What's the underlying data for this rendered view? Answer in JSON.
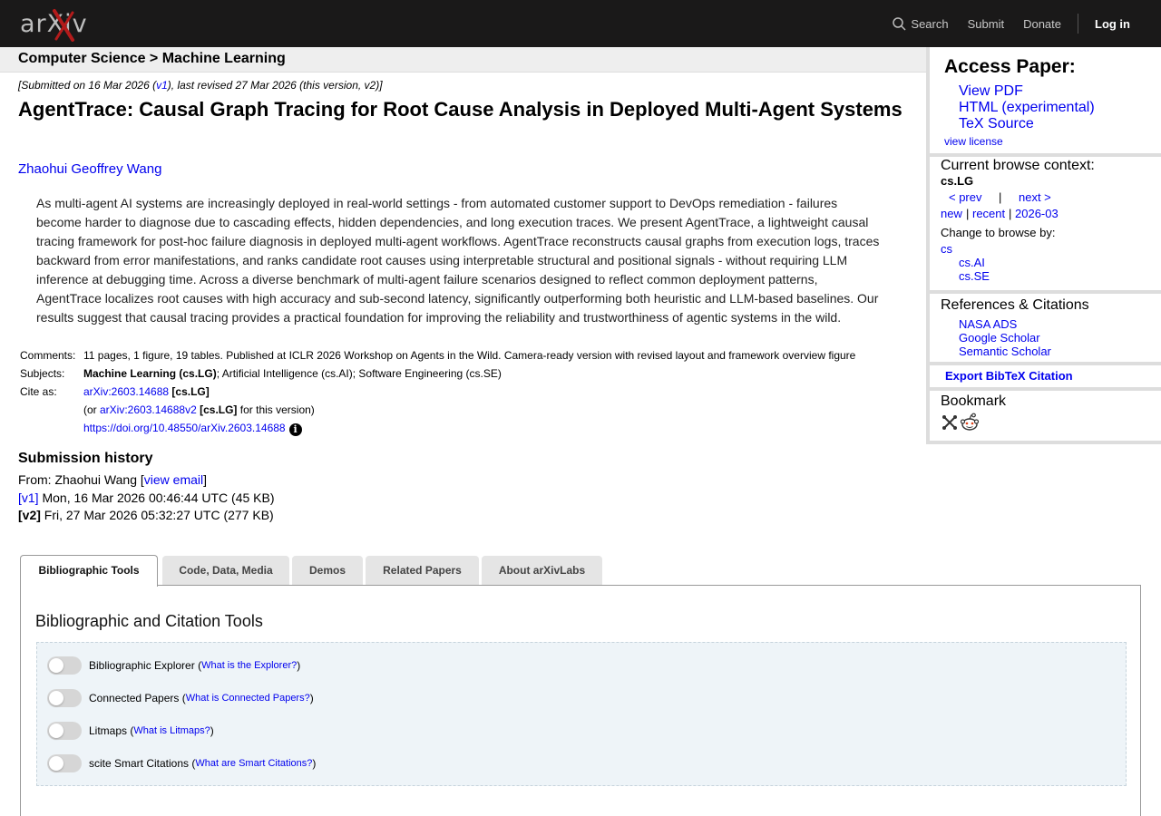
{
  "header": {
    "logo_text": "arXiv",
    "nav": {
      "search": "Search",
      "submit": "Submit",
      "donate": "Donate",
      "login": "Log in"
    }
  },
  "context": {
    "breadcrumb": "Computer Science > Machine Learning"
  },
  "paper": {
    "dateline_prefix": "[Submitted on 16 Mar 2026 (",
    "dateline_v1": "v1",
    "dateline_suffix": "), last revised 27 Mar 2026 (this version, v2)]",
    "title": "AgentTrace: Causal Graph Tracing for Root Cause Analysis in Deployed Multi-Agent Systems",
    "author": "Zhaohui Geoffrey Wang",
    "abstract": "As multi-agent AI systems are increasingly deployed in real-world settings - from automated customer support to DevOps remediation - failures become harder to diagnose due to cascading effects, hidden dependencies, and long execution traces. We present AgentTrace, a lightweight causal tracing framework for post-hoc failure diagnosis in deployed multi-agent workflows. AgentTrace reconstructs causal graphs from execution logs, traces backward from error manifestations, and ranks candidate root causes using interpretable structural and positional signals - without requiring LLM inference at debugging time. Across a diverse benchmark of multi-agent failure scenarios designed to reflect common deployment patterns, AgentTrace localizes root causes with high accuracy and sub-second latency, significantly outperforming both heuristic and LLM-based baselines. Our results suggest that causal tracing provides a practical foundation for improving the reliability and trustworthiness of agentic systems in the wild."
  },
  "meta": {
    "comments_label": "Comments:",
    "comments": "11 pages, 1 figure, 19 tables. Published at ICLR 2026 Workshop on Agents in the Wild. Camera-ready version with revised layout and framework overview figure",
    "subjects_label": "Subjects:",
    "subject_primary": "Machine Learning (cs.LG)",
    "subject_rest": "; Artificial Intelligence (cs.AI); Software Engineering (cs.SE)",
    "cite_label": "Cite as:",
    "cite_id": "arXiv:2603.14688",
    "cite_cat": "[cs.LG]",
    "cite_or": "(or ",
    "cite_v2": "arXiv:2603.14688v2",
    "cite_v2_cat": "[cs.LG]",
    "cite_v2_tail": " for this version)",
    "doi": "https://doi.org/10.48550/arXiv.2603.14688",
    "info_glyph": "i"
  },
  "history": {
    "title": "Submission history",
    "from_prefix": "From: Zhaohui Wang [",
    "from_link": "view email",
    "from_suffix": "]",
    "v1_label": "[v1]",
    "v1_text": " Mon, 16 Mar 2026 00:46:44 UTC (45 KB)",
    "v2_label": "[v2]",
    "v2_text": " Fri, 27 Mar 2026 05:32:27 UTC (277 KB)"
  },
  "sidebar": {
    "access_title": "Access Paper:",
    "view_pdf": "View PDF",
    "html": "HTML (experimental)",
    "tex": "TeX Source",
    "license": "view license",
    "browse_title": "Current browse context:",
    "browse_ctx": "cs.LG",
    "prev": "< prev",
    "pipe": "|",
    "next": "next >",
    "new": "new",
    "recent": "recent",
    "month": "2026-03",
    "change_label": "Change to browse by:",
    "cs": "cs",
    "cs_ai": "cs.AI",
    "cs_se": "cs.SE",
    "refs_title": "References & Citations",
    "nasa": "NASA ADS",
    "scholar": "Google Scholar",
    "semantic": "Semantic Scholar",
    "bibtex": "Export BibTeX Citation",
    "bookmark_title": "Bookmark"
  },
  "tabs": [
    "Bibliographic Tools",
    "Code, Data, Media",
    "Demos",
    "Related Papers",
    "About arXivLabs"
  ],
  "panel": {
    "title": "Bibliographic and Citation Tools",
    "tools": [
      {
        "label": "Bibliographic Explorer",
        "link": "What is the Explorer?"
      },
      {
        "label": "Connected Papers",
        "link": "What is Connected Papers?"
      },
      {
        "label": "Litmaps",
        "link": "What is Litmaps?"
      },
      {
        "label": "scite Smart Citations",
        "link": "What are Smart Citations?"
      }
    ]
  },
  "colors": {
    "header_bg": "#1a1919",
    "logo_red": "#b31b1b",
    "link": "#0000ee",
    "toolbox_bg": "#eef4f8"
  }
}
